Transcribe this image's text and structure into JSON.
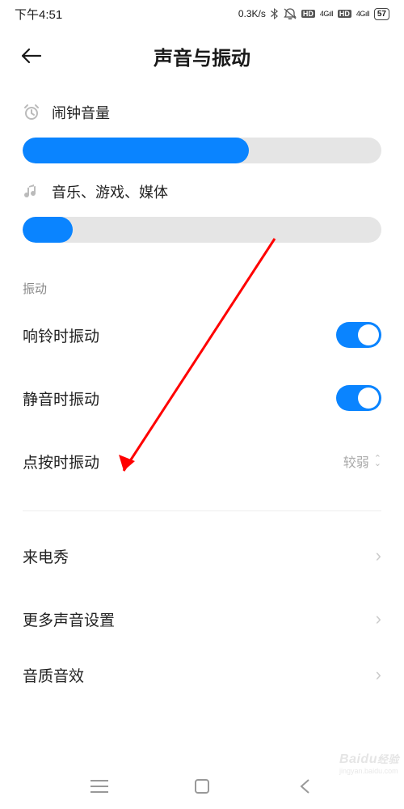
{
  "statusbar": {
    "time": "下午4:51",
    "speed": "0.3K/s",
    "battery": "57",
    "hd": "HD",
    "net": "4G"
  },
  "header": {
    "title": "声音与振动"
  },
  "sliders": {
    "alarm": {
      "label": "闹钟音量",
      "value": 63
    },
    "media": {
      "label": "音乐、游戏、媒体",
      "value": 14
    }
  },
  "vibration": {
    "group_label": "振动",
    "ring": {
      "label": "响铃时振动",
      "on": true
    },
    "silent": {
      "label": "静音时振动",
      "on": true
    },
    "haptic": {
      "label": "点按时振动",
      "value": "较弱"
    }
  },
  "more": {
    "callshow": {
      "label": "来电秀"
    },
    "moresound": {
      "label": "更多声音设置"
    },
    "quality": {
      "label": "音质音效"
    }
  },
  "watermark": {
    "brand": "Baidu",
    "sub": "jingyan.baidu.com"
  }
}
